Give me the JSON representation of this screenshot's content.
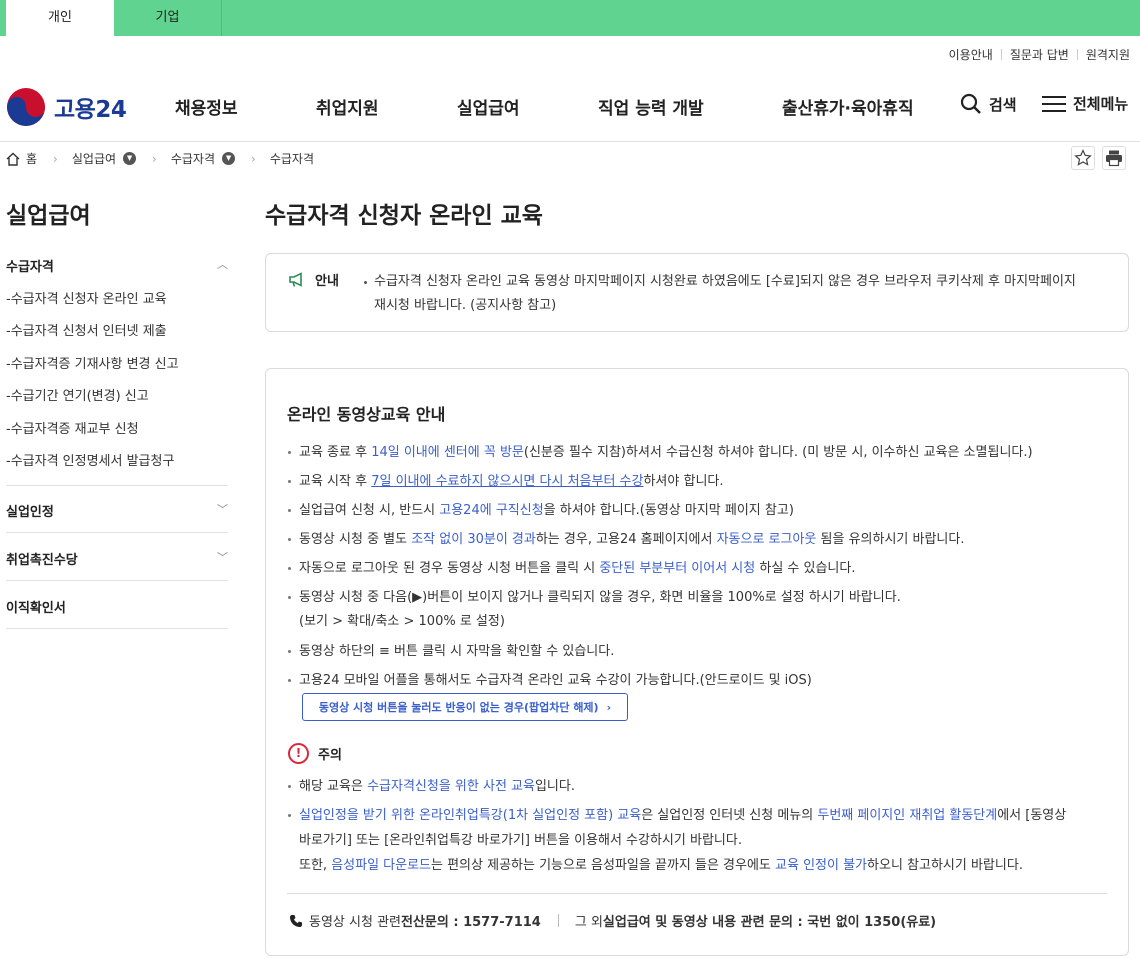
{
  "top_tabs": [
    {
      "label": "개인",
      "active": true
    },
    {
      "label": "기업",
      "active": false
    }
  ],
  "util_links": [
    "이용안내",
    "질문과 답변",
    "원격지원"
  ],
  "brand": {
    "name": "고용24"
  },
  "nav": [
    "채용정보",
    "취업지원",
    "실업급여",
    "직업 능력 개발",
    "출산휴가·육아휴직"
  ],
  "header_actions": {
    "search": "검색",
    "menu": "전체메뉴"
  },
  "breadcrumb": [
    "홈",
    "실업급여",
    "수급자격",
    "수급자격"
  ],
  "sidebar": {
    "title": "실업급여",
    "section1": "수급자격",
    "items": [
      "-수급자격 신청자 온라인 교육",
      "-수급자격 신청서 인터넷 제출",
      "-수급자격증 기재사항 변경 신고",
      "-수급기간 연기(변경) 신고",
      "-수급자격증 재교부 신청",
      "-수급자격 인정명세서 발급청구"
    ],
    "sections": [
      "실업인정",
      "취업촉진수당",
      "이직확인서"
    ]
  },
  "page_title": "수급자격 신청자 온라인 교육",
  "notice": {
    "label": "안내",
    "line1": "수급자격 신청자 온라인 교육 동영상 마지막페이지 시청완료 하였음에도 [수료]되지 않은 경우 브라우저 쿠키삭제 후 마지막페이지",
    "line2": "재시청 바랍니다. (공지사항 참고)"
  },
  "guide": {
    "title": "온라인 동영상교육 안내",
    "b1": {
      "p1": "교육 종료 후 ",
      "h": "14일 이내에 센터에 꼭 방문",
      "p2": "(신분증 필수 지참)하셔서 수급신청 하셔야 합니다. (미 방문 시, 이수하신 교육은 소멸됩니다.)"
    },
    "b2": {
      "p1": "교육 시작 후 ",
      "h": "7일 이내에 수료하지 않으시면 다시 처음부터 수강",
      "p2": "하셔야 합니다."
    },
    "b3": {
      "p1": "실업급여 신청 시, 반드시 ",
      "h": "고용24에 구직신청",
      "p2": "을 하셔야 합니다.(동영상 마지막 페이지 참고)"
    },
    "b4": {
      "p1": "동영상 시청 중 별도 ",
      "h1": "조작 없이 30분이 경과",
      "p2": "하는 경우, 고용24 홈페이지에서 ",
      "h2": "자동으로 로그아웃",
      "p3": " 됨을 유의하시기 바랍니다."
    },
    "b5": {
      "p1": "자동으로 로그아웃 된 경우 동영상 시청 버튼을 클릭 시 ",
      "h": "중단된 부분부터 이어서 시청",
      "p2": " 하실 수 있습니다."
    },
    "b6": {
      "l1": "동영상 시청 중 다음(▶)버튼이 보이지 않거나 클릭되지 않을 경우, 화면 비율을 100%로 설정 하시기 바랍니다.",
      "l2": "(보기 > 확대/축소 > 100% 로 설정)"
    },
    "b7": "동영상 하단의 ≡ 버튼 클릭 시 자막을 확인할 수 있습니다.",
    "b8": "고용24 모바일 어플을 통해서도 수급자격 온라인 교육 수강이 가능합니다.(안드로이드 및 iOS)",
    "popup_button": "동영상 시청 버튼을 눌러도 반응이 없는 경우(팝업차단 해제)"
  },
  "caution": {
    "label": "주의",
    "c1": {
      "p1": "해당 교육은 ",
      "h": "수급자격신청을 위한 사전 교육",
      "p2": "입니다."
    },
    "c2": {
      "h1": "실업인정을 받기 위한 온라인취업특강(1차 실업인정 포함) 교육",
      "p1": "은 실업인정 인터넷 신청 메뉴의 ",
      "h2": "두번째 페이지인 재취업 활동단계",
      "p2": "에서 [동영상",
      "l2": "바로가기] 또는 [온라인취업특강 바로가기] 버튼을 이용해서 수강하시기 바랍니다."
    },
    "c3": {
      "p1": "또한, ",
      "h1": "음성파일 다운로드",
      "p2": "는 편의상 제공하는 기능으로 음성파일을 끝까지 들은 경우에도 ",
      "h2": "교육 인정이 불가",
      "p3": "하오니 참고하시기 바랍니다."
    }
  },
  "contact": {
    "a1": "동영상 시청 관련 ",
    "a2": "전산문의 : 1577-7114",
    "b1": "그 외 ",
    "b2": "실업급여 및 동영상 내용 관련 문의 : 국번 없이 1350(유료)"
  }
}
